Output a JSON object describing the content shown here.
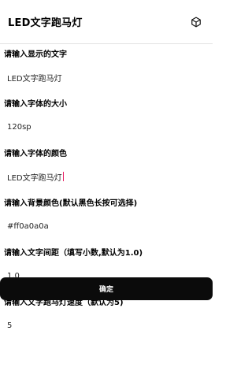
{
  "app": {
    "title": "LED文字跑马灯",
    "action_icon": "cube-icon"
  },
  "fields": [
    {
      "label": "请输入显示的文字",
      "value": "LED文字跑马灯"
    },
    {
      "label": "请输入字体的大小",
      "value": "120sp"
    },
    {
      "label": "请输入字体的颜色",
      "value": "LED文字跑马灯"
    },
    {
      "label": "请输入背景颜色(默认黑色长按可选择)",
      "value": "#ff0a0a0a"
    },
    {
      "label": "请输入文字间距（填写小数,默认为1.0)",
      "value": "1.0"
    },
    {
      "label": "请输入文字跑马灯速度（默认为5)",
      "value": "5"
    }
  ],
  "confirm_label": "确定"
}
